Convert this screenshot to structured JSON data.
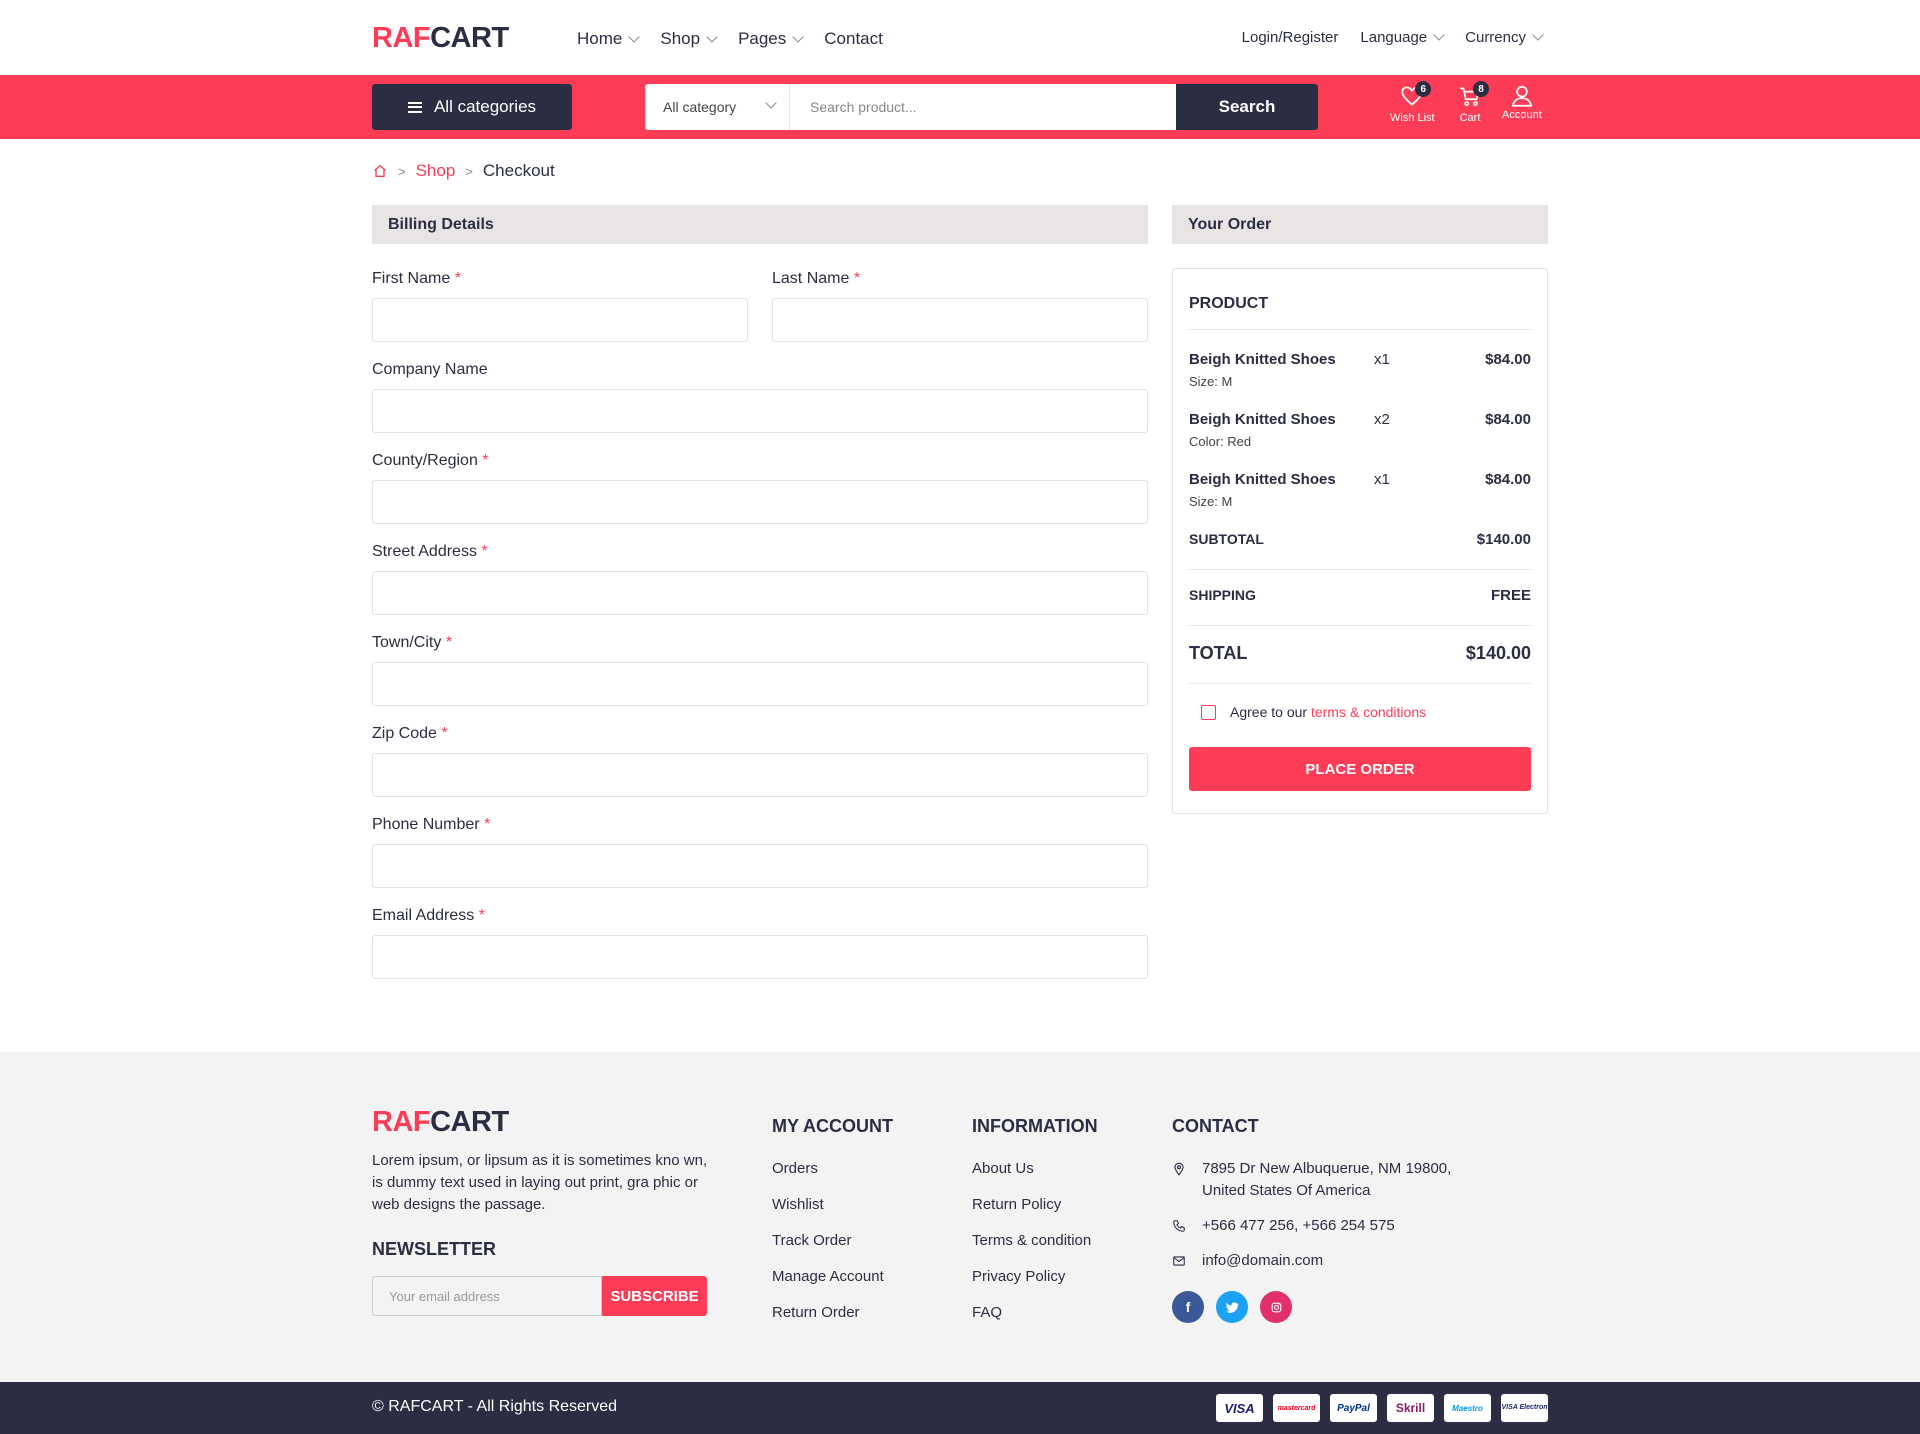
{
  "brand": {
    "part1": "RAF",
    "part2": "CART"
  },
  "nav": {
    "items": [
      {
        "label": "Home"
      },
      {
        "label": "Shop"
      },
      {
        "label": "Pages"
      },
      {
        "label": "Contact"
      }
    ]
  },
  "topright": {
    "login": "Login/Register",
    "language": "Language",
    "currency": "Currency"
  },
  "searchbar": {
    "all_categories": "All categories",
    "category_select": "All category",
    "placeholder": "Search product...",
    "button": "Search"
  },
  "tools": {
    "wishlist": {
      "label": "Wish List",
      "count": "6"
    },
    "cart": {
      "label": "Cart",
      "count": "8"
    },
    "account": {
      "label": "Account"
    }
  },
  "breadcrumb": {
    "shop": "Shop",
    "current": "Checkout"
  },
  "billing": {
    "title": "Billing Details",
    "fields": {
      "first_name": "First Name",
      "last_name": "Last Name",
      "company": "Company Name",
      "county": "County/Region",
      "street": "Street Address",
      "town": "Town/City",
      "zip": "Zip Code",
      "phone": "Phone Number",
      "email": "Email Address"
    },
    "required_mark": "*"
  },
  "order": {
    "title": "Your Order",
    "product_header": "PRODUCT",
    "items": [
      {
        "name": "Beigh Knitted Shoes",
        "option": "Size: M",
        "qty": "x1",
        "price": "$84.00"
      },
      {
        "name": "Beigh Knitted Shoes",
        "option": "Color: Red",
        "qty": "x2",
        "price": "$84.00"
      },
      {
        "name": "Beigh Knitted Shoes",
        "option": "Size: M",
        "qty": "x1",
        "price": "$84.00"
      }
    ],
    "subtotal_label": "SUBTOTAL",
    "subtotal": "$140.00",
    "shipping_label": "SHIPPING",
    "shipping": "FREE",
    "total_label": "TOTAL",
    "total": "$140.00",
    "agree_text": "Agree to our",
    "terms": "terms & conditions",
    "place_order": "PLACE ORDER"
  },
  "footer": {
    "description": "Lorem ipsum, or lipsum as it is sometimes kno wn, is dummy text used in laying out print, gra phic or web designs the passage.",
    "newsletter_title": "NEWSLETTER",
    "newsletter_placeholder": "Your email address",
    "subscribe": "SUBSCRIBE",
    "my_account": {
      "title": "MY ACCOUNT",
      "links": [
        "Orders",
        "Wishlist",
        "Track Order",
        "Manage Account",
        "Return Order"
      ]
    },
    "information": {
      "title": "INFORMATION",
      "links": [
        "About Us",
        "Return Policy",
        "Terms & condition",
        "Privacy Policy",
        "FAQ"
      ]
    },
    "contact": {
      "title": "CONTACT",
      "address_line1": "7895 Dr New Albuquerue, NM 19800,",
      "address_line2": "United States Of America",
      "phone": "+566 477 256, +566 254 575",
      "email": "info@domain.com"
    },
    "copyright": "© RAFCART - All Rights Reserved",
    "payment": [
      "VISA",
      "mastercard",
      "PayPal",
      "Skrill",
      "Maestro",
      "VISA Electron"
    ]
  },
  "colors": {
    "accent": "#fd3d57",
    "dark": "#2b2d42",
    "facebook": "#3b5998",
    "twitter": "#1da1f2",
    "instagram": "#e1306c"
  }
}
